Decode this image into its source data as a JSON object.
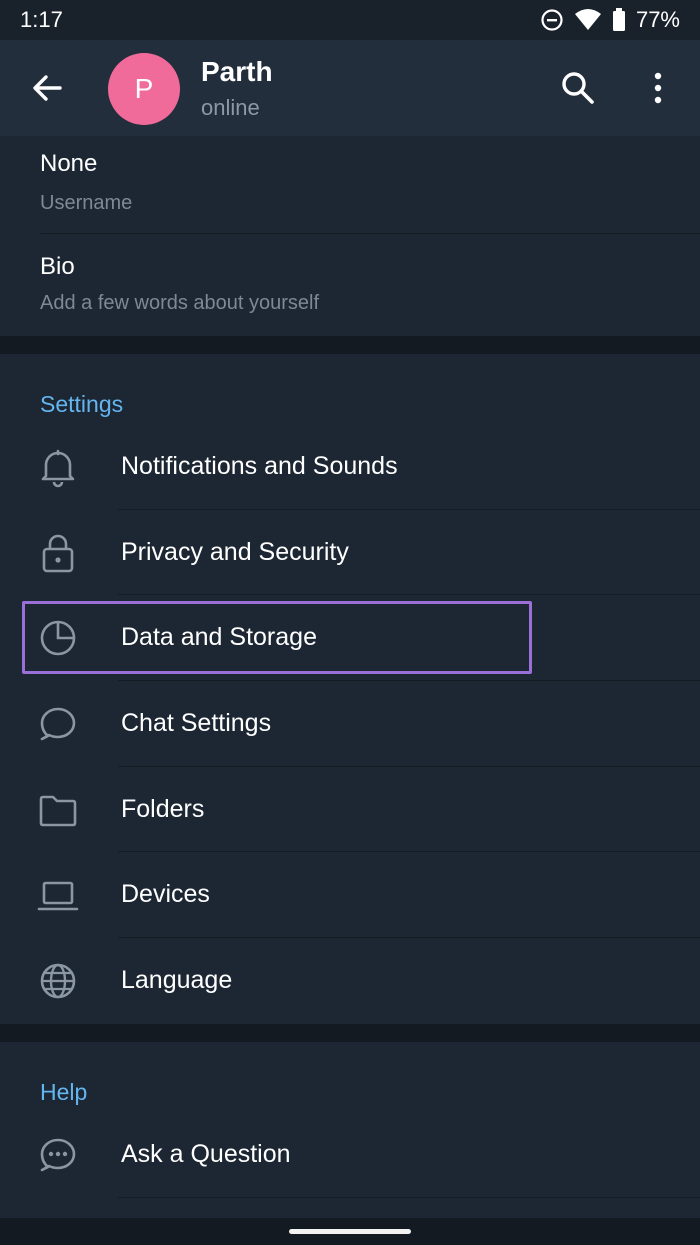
{
  "status_bar": {
    "time": "1:17",
    "battery": "77%"
  },
  "header": {
    "avatar_letter": "P",
    "name": "Parth",
    "status": "online",
    "avatar_color": "#f06b9a"
  },
  "profile": {
    "username_value": "None",
    "username_label": "Username",
    "bio_title": "Bio",
    "bio_placeholder": "Add a few words about yourself"
  },
  "settings": {
    "section_title": "Settings",
    "items": [
      {
        "label": "Notifications and Sounds",
        "icon": "bell-icon"
      },
      {
        "label": "Privacy and Security",
        "icon": "lock-icon"
      },
      {
        "label": "Data and Storage",
        "icon": "pie-chart-icon",
        "highlighted": true
      },
      {
        "label": "Chat Settings",
        "icon": "chat-bubble-icon"
      },
      {
        "label": "Folders",
        "icon": "folder-icon"
      },
      {
        "label": "Devices",
        "icon": "laptop-icon"
      },
      {
        "label": "Language",
        "icon": "globe-icon"
      }
    ]
  },
  "help": {
    "section_title": "Help",
    "items": [
      {
        "label": "Ask a Question",
        "icon": "chat-dots-icon"
      }
    ]
  },
  "colors": {
    "background": "#1d2733",
    "header": "#232e3c",
    "accent": "#64b5ef",
    "highlight_border": "#9a70d8"
  }
}
